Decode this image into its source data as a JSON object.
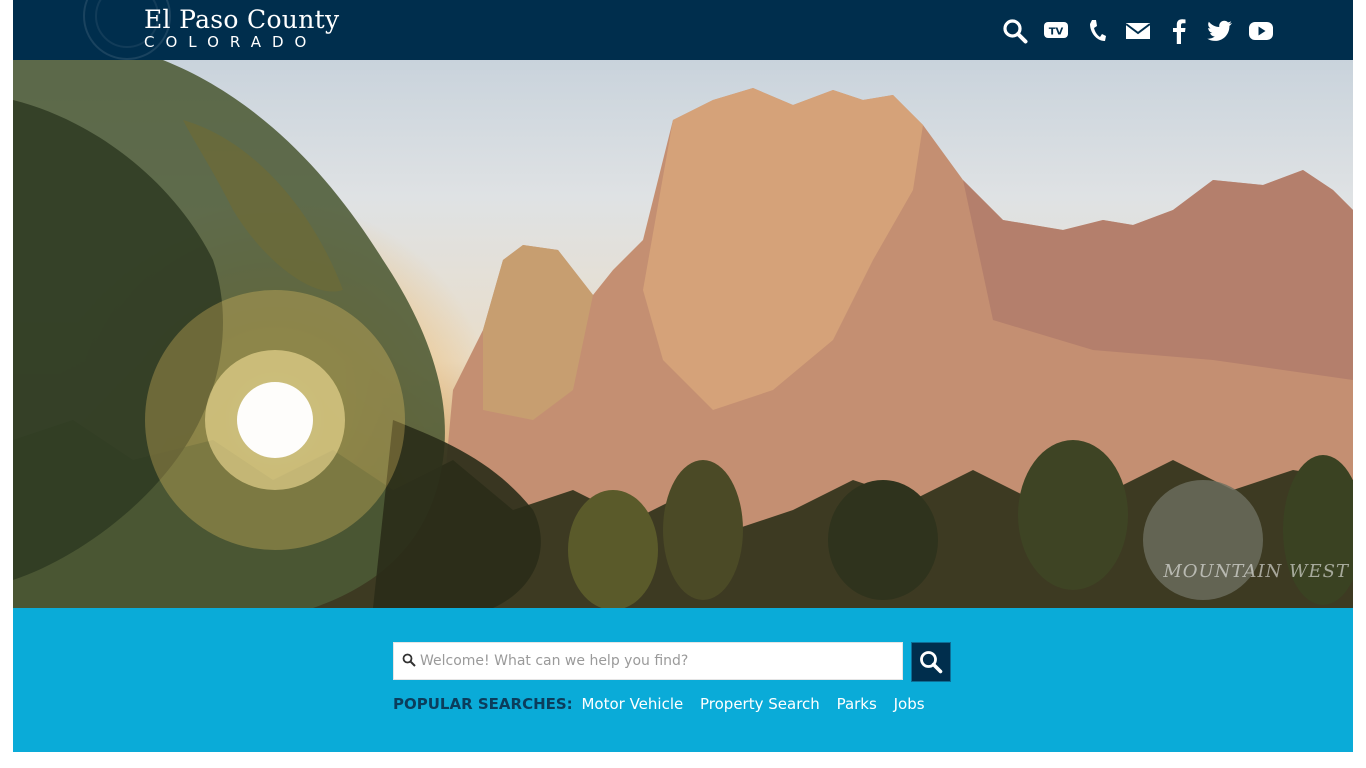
{
  "header": {
    "title": "El Paso County",
    "subtitle": "COLORADO",
    "icons": [
      "search-icon",
      "tv-icon",
      "phone-icon",
      "mail-icon",
      "facebook-icon",
      "twitter-icon",
      "youtube-icon"
    ],
    "tv_label": "TV"
  },
  "hero": {
    "credit": "MOUNTAIN WEST"
  },
  "search": {
    "placeholder": "Welcome! What can we help you find?",
    "popular_label": "POPULAR SEARCHES:",
    "popular_links": [
      "Motor Vehicle",
      "Property Search",
      "Parks",
      "Jobs"
    ]
  },
  "colors": {
    "header_bg": "#002e4d",
    "band_bg": "#0aabd8",
    "button_bg": "#002e4d",
    "popular_label": "#0b3d5c"
  }
}
